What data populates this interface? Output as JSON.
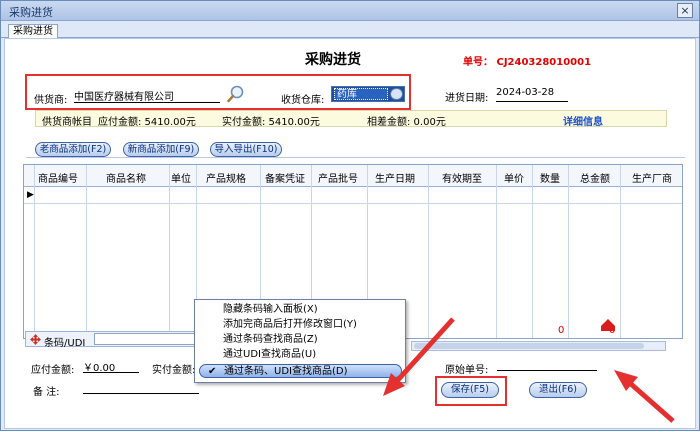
{
  "window": {
    "title": "采购进货",
    "close": "×"
  },
  "tab": {
    "label": "采购进货"
  },
  "header": {
    "heading": "采购进货",
    "order_no": "单号：  CJ240328010001"
  },
  "form": {
    "supplier_label": "供货商:",
    "supplier_value": "中国医疗器械有限公司",
    "warehouse_label": "收货仓库:",
    "warehouse_value": "药库",
    "date_label": "进货日期:",
    "date_value": "2024-03-28"
  },
  "info": {
    "account_label": "供货商帐目",
    "payable": "应付金额: 5410.00元",
    "paid": "实付金额: 5410.00元",
    "diff": "相差金额: 0.00元",
    "detail_link": "详细信息"
  },
  "toolbar": {
    "old_add": "老商品添加(F2)",
    "new_add": "新商品添加(F9)",
    "import_export": "导入导出(F10)"
  },
  "grid": {
    "columns": [
      "商品编号",
      "商品名称",
      "单位",
      "产品规格",
      "备案凭证",
      "产品批号",
      "生产日期",
      "有效期至",
      "单价",
      "数量",
      "总金额",
      "生产厂商"
    ],
    "row_marker": "▶",
    "totals": {
      "qty": "0",
      "amount": "0"
    }
  },
  "barcode": {
    "label": "条码/UDI",
    "close": "×"
  },
  "menu": {
    "items": [
      "隐藏条码输入面板(X)",
      "添加完商品后打开修改窗口(Y)",
      "通过条码查找商品(Z)",
      "通过UDI查找商品(U)",
      "通过条码、UDI查找商品(D)"
    ],
    "checked_mark": "✔"
  },
  "footer": {
    "payable_label": "应付金额:",
    "payable_value": "￥0.00",
    "paid_label": "实付金额:",
    "remark_label": "备      注:",
    "orig_label": "原始单号:",
    "save": "保存(F5)",
    "exit": "退出(F6)"
  },
  "colors": {
    "accent_red": "#e53030",
    "link_blue": "#1a4fc8"
  }
}
